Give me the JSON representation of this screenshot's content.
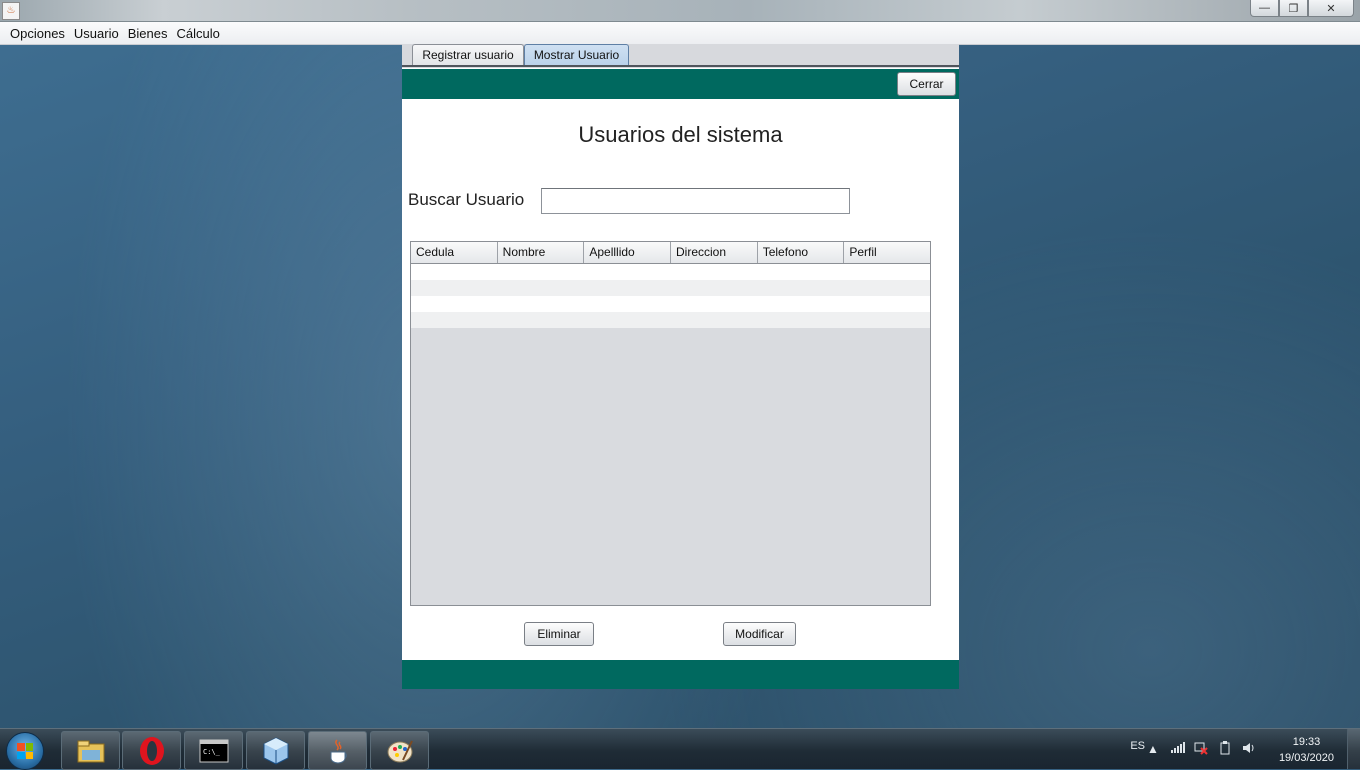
{
  "window": {
    "title": "",
    "controls": {
      "minimize": "—",
      "restore": "❐",
      "close": "✕"
    }
  },
  "menubar": [
    "Opciones",
    "Usuario",
    "Bienes",
    "Cálculo"
  ],
  "tabs": [
    {
      "label": "Registrar usuario",
      "selected": false
    },
    {
      "label": "Mostrar Usuario",
      "selected": true
    }
  ],
  "toolbar": {
    "close_label": "Cerrar"
  },
  "main": {
    "title": "Usuarios del sistema",
    "search": {
      "label": "Buscar Usuario",
      "value": "",
      "placeholder": ""
    }
  },
  "table": {
    "columns": [
      "Cedula",
      "Nombre",
      "Apelllido",
      "Direccion",
      "Telefono",
      "Perfil"
    ],
    "rows": []
  },
  "actions": {
    "delete_label": "Eliminar",
    "modify_label": "Modificar"
  },
  "colors": {
    "header_bar": "#00695f",
    "selected_tab": "#b9d1ea"
  },
  "taskbar": {
    "apps": [
      "file-explorer-icon",
      "opera-icon",
      "command-prompt-icon",
      "virtualbox-icon",
      "java-icon",
      "paint-icon"
    ],
    "tray": {
      "language": "ES",
      "time": "19:33",
      "date": "19/03/2020"
    }
  }
}
